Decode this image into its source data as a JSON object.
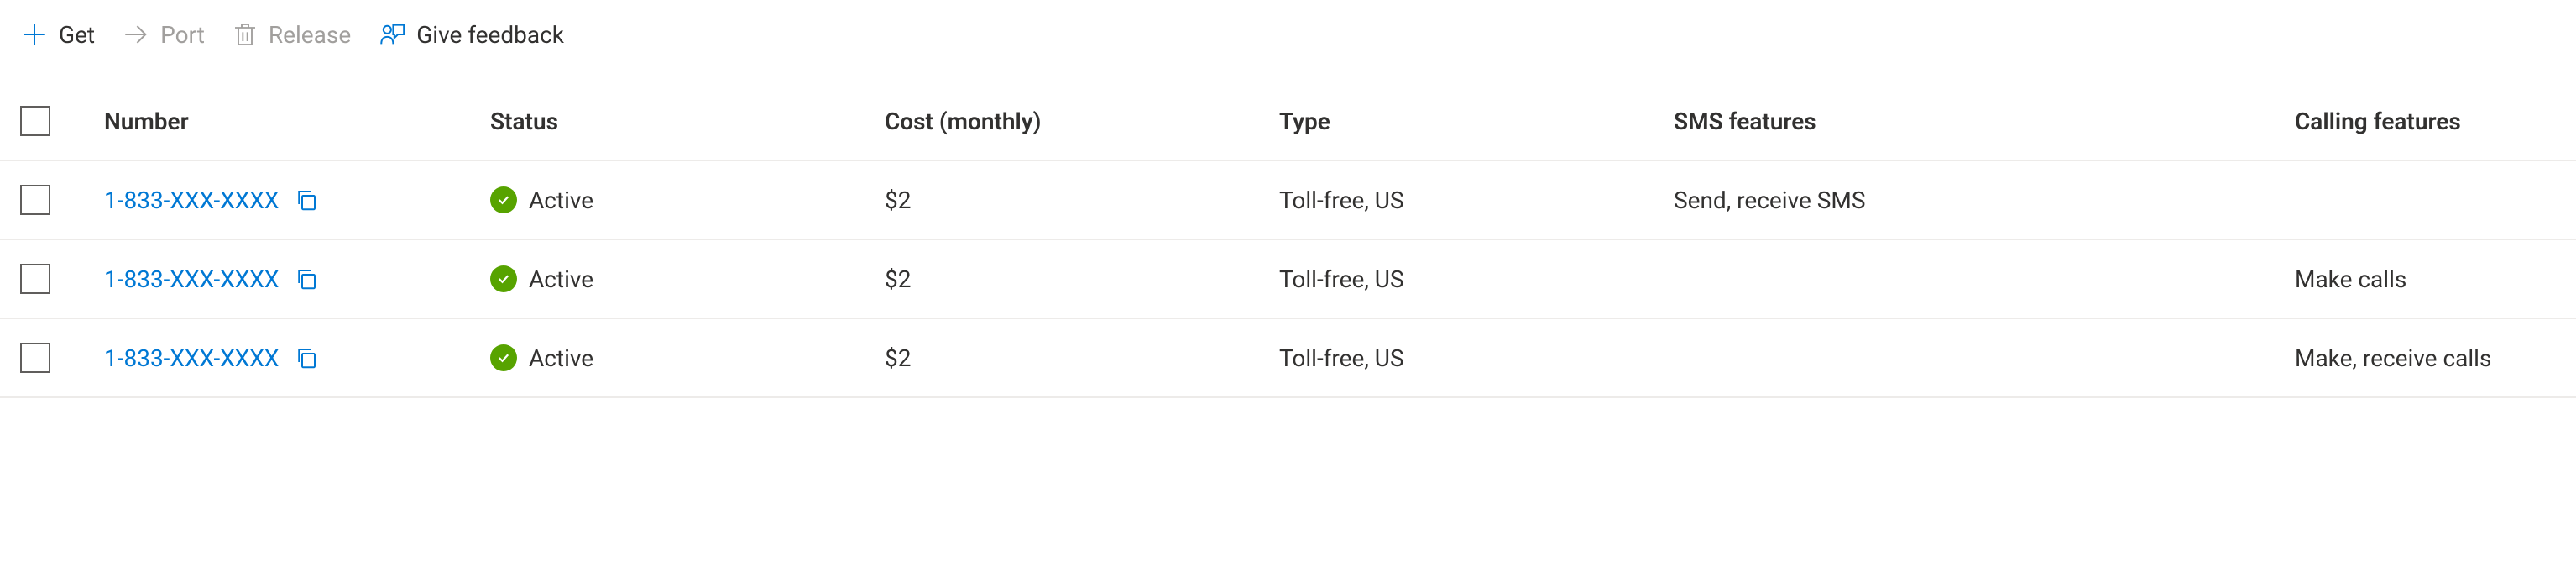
{
  "toolbar": {
    "get": "Get",
    "port": "Port",
    "release": "Release",
    "feedback": "Give feedback"
  },
  "columns": {
    "number": "Number",
    "status": "Status",
    "cost": "Cost (monthly)",
    "type": "Type",
    "sms": "SMS features",
    "calling": "Calling features"
  },
  "rows": [
    {
      "number": "1-833-XXX-XXXX",
      "status": "Active",
      "cost": "$2",
      "type": "Toll-free, US",
      "sms": "Send, receive SMS",
      "calling": ""
    },
    {
      "number": "1-833-XXX-XXXX",
      "status": "Active",
      "cost": "$2",
      "type": "Toll-free, US",
      "sms": "",
      "calling": "Make calls"
    },
    {
      "number": "1-833-XXX-XXXX",
      "status": "Active",
      "cost": "$2",
      "type": "Toll-free, US",
      "sms": "",
      "calling": "Make, receive calls"
    }
  ]
}
